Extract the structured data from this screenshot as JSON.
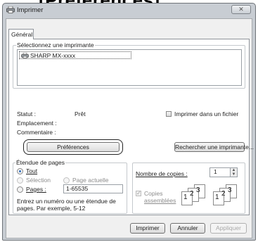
{
  "heading": "[Préférences]",
  "window": {
    "title": "Imprimer",
    "close_glyph": "✕"
  },
  "tab": {
    "label": "Général"
  },
  "printer_group": {
    "title": "Sélectionnez une imprimante",
    "printers": [
      "SHARP MX-xxxx"
    ]
  },
  "status": {
    "status_label": "Statut :",
    "status_value": "Prêt",
    "location_label": "Emplacement :",
    "comment_label": "Commentaire :",
    "print_to_file_label": "Imprimer dans un fichier",
    "print_to_file_checked": false
  },
  "buttons": {
    "preferences": "Préférences",
    "find_printer": "Rechercher une imprimante...",
    "print": "Imprimer",
    "cancel": "Annuler",
    "apply": "Appliquer"
  },
  "page_range": {
    "title": "Étendue de pages",
    "all": "Tout",
    "selection": "Sélection",
    "current_page": "Page actuelle",
    "pages": "Pages :",
    "pages_value": "1-65535",
    "selected": "all",
    "help_line1": "Entrez un numéro ou une étendue de",
    "help_line2": "pages. Par exemple, 5-12"
  },
  "copies": {
    "label": "Nombre de copies :",
    "value": "1",
    "collate_line1": "Copies",
    "collate_line2": "assemblées",
    "collate_checked": true,
    "collate_enabled": false,
    "stack_digits": [
      "1",
      "2",
      "3"
    ]
  },
  "colors": {
    "accent": "#2f6ebd",
    "chrome": "#c8cdd3",
    "panel": "#ffffff"
  },
  "icons": {
    "window": "printer-icon",
    "list_item": "printer-icon",
    "close": "close-icon"
  }
}
